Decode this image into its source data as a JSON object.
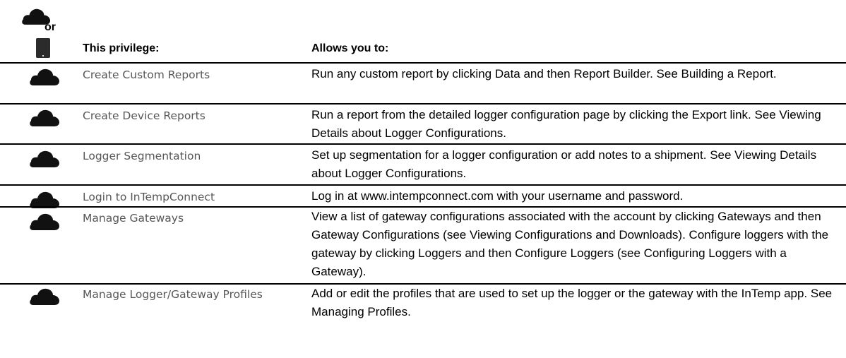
{
  "legend": {
    "or_label": "or",
    "cloud_icon": "cloud-icon",
    "device_icon": "tablet-icon"
  },
  "table": {
    "headers": {
      "privilege": "This privilege:",
      "allows": "Allows you to:"
    },
    "rows": [
      {
        "icon": "cloud-icon",
        "privilege": "Create Custom Reports",
        "description": "Run any custom report by clicking Data and then Report Builder. See Building a Report."
      },
      {
        "icon": "cloud-icon",
        "privilege": "Create Device Reports",
        "description": "Run a report from the detailed logger configuration page by clicking the Export link. See Viewing Details about Logger Configurations."
      },
      {
        "icon": "cloud-icon",
        "privilege": "Logger Segmentation",
        "description": "Set up segmentation for a logger configuration or add notes to a shipment. See Viewing Details about Logger Configurations."
      },
      {
        "icon": "cloud-icon",
        "privilege": "Login to InTempConnect",
        "description": "Log in at www.intempconnect.com with your username and password."
      },
      {
        "icon": "cloud-icon",
        "privilege": "Manage Gateways",
        "description": "View a list of gateway configurations associated with the account by clicking Gateways and then Gateway Configurations (see Viewing Configurations and Downloads). Configure loggers with the gateway by clicking Loggers and then Configure Loggers (see Configuring Loggers with a Gateway)."
      },
      {
        "icon": "cloud-icon",
        "privilege": "Manage Logger/Gateway Profiles",
        "description": "Add or edit the profiles that are used to set up the logger or the gateway with the InTemp app. See Managing Profiles."
      }
    ]
  }
}
